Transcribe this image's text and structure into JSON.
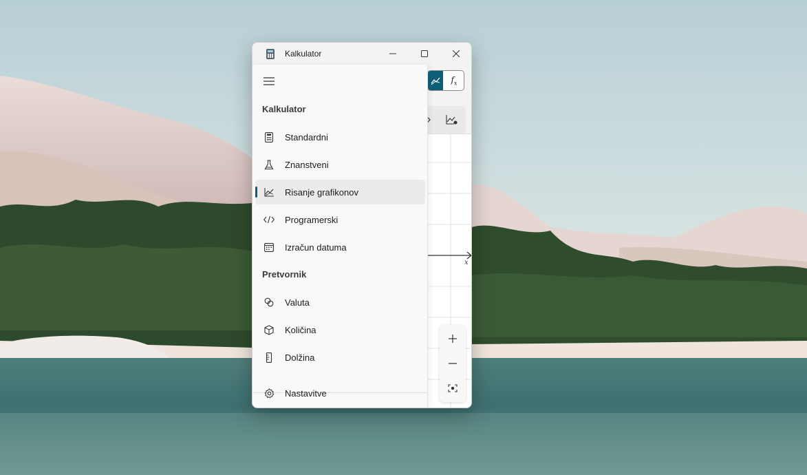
{
  "window": {
    "title": "Kalkulator",
    "icon": "calculator-app-icon",
    "caption_buttons": [
      "minimize-icon",
      "maximize-icon",
      "close-icon"
    ]
  },
  "graph": {
    "mode_toggle": {
      "graph_icon": "graph-icon",
      "function_label": "f",
      "function_sub": "x",
      "active": "graph"
    },
    "toolbar_icons": [
      "share-icon",
      "graph-settings-icon"
    ],
    "axis_label_x": "x",
    "zoom": {
      "in": "zoom-in-icon",
      "out": "zoom-out-icon",
      "reset": "fit-view-icon"
    }
  },
  "nav": {
    "menu_icon": "hamburger-icon",
    "sections": [
      {
        "header": "Kalkulator",
        "items": [
          {
            "label": "Standardni",
            "icon": "standard-calculator-icon",
            "selected": false
          },
          {
            "label": "Znanstveni",
            "icon": "flask-icon",
            "selected": false
          },
          {
            "label": "Risanje grafikonov",
            "icon": "graph-icon",
            "selected": true
          },
          {
            "label": "Programerski",
            "icon": "code-icon",
            "selected": false
          },
          {
            "label": "Izračun datuma",
            "icon": "calendar-icon",
            "selected": false
          }
        ]
      },
      {
        "header": "Pretvornik",
        "items": [
          {
            "label": "Valuta",
            "icon": "currency-icon",
            "selected": false
          },
          {
            "label": "Količina",
            "icon": "cube-icon",
            "selected": false
          },
          {
            "label": "Dolžina",
            "icon": "ruler-icon",
            "selected": false
          }
        ]
      }
    ],
    "settings": {
      "label": "Nastavitve",
      "icon": "gear-icon"
    }
  },
  "colors": {
    "accent": "#0f5e78",
    "window_bg": "#f3f3f3",
    "pane_bg": "#f9f9f9",
    "selected_bg": "#ebebeb"
  }
}
